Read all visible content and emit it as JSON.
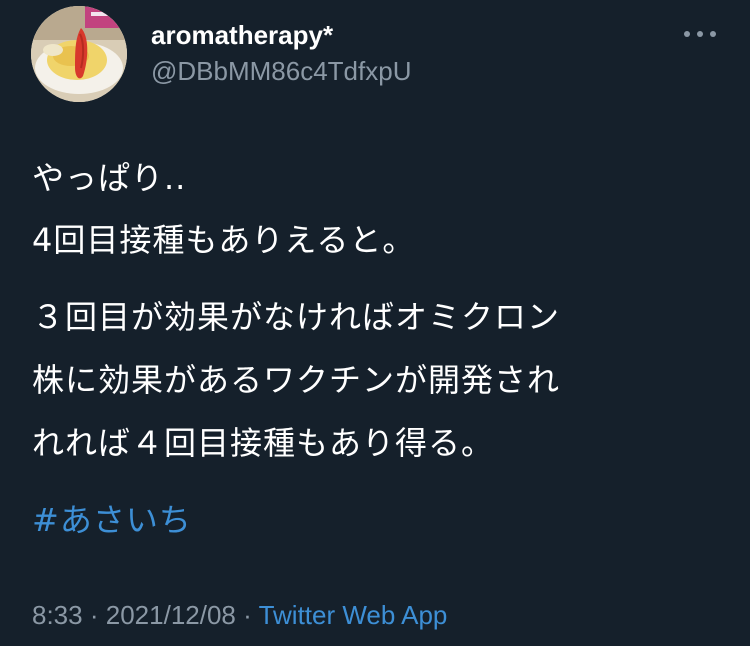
{
  "user": {
    "display_name": "aromatherapy*",
    "handle": "@DBbMM86c4TdfxpU",
    "avatar_icon": "omurice-photo-avatar"
  },
  "menu": {
    "more_icon": "more-horizontal-icon"
  },
  "tweet": {
    "lines": [
      "やっぱり..",
      "4回目接種もありえると。",
      "３回目が効果がなければオミクロン",
      "株に効果があるワクチンが開発され",
      "れれば４回目接種もあり得る。"
    ],
    "hashtag": "#あさいち"
  },
  "meta": {
    "time": "8:33",
    "date": "2021/12/08",
    "separator": "·",
    "source": "Twitter Web App"
  },
  "colors": {
    "background": "#15202b",
    "text": "#ffffff",
    "secondary": "#8b98a5",
    "link": "#3d8fd6"
  }
}
